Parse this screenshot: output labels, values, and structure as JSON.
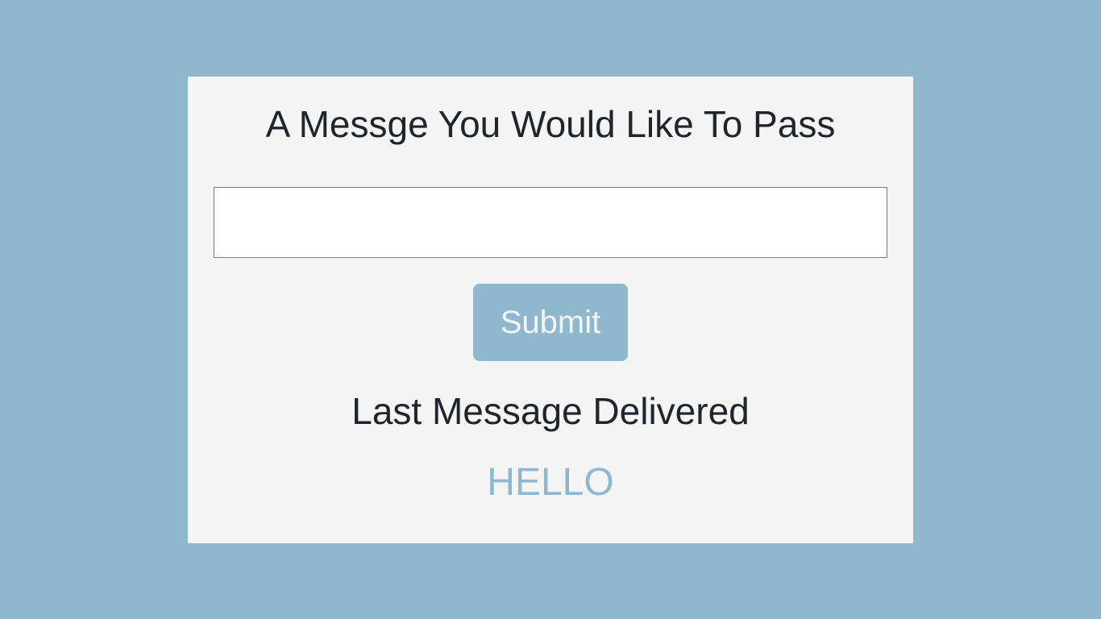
{
  "form": {
    "title": "A Messge You Would Like To Pass",
    "input_value": "",
    "input_placeholder": "",
    "submit_label": "Submit"
  },
  "result": {
    "heading": "Last Message Delivered",
    "message": "HELLO"
  },
  "colors": {
    "background": "#8fb8cf",
    "card": "#f4f4f4",
    "accent": "#8fb8cf",
    "text": "#1e252b"
  }
}
